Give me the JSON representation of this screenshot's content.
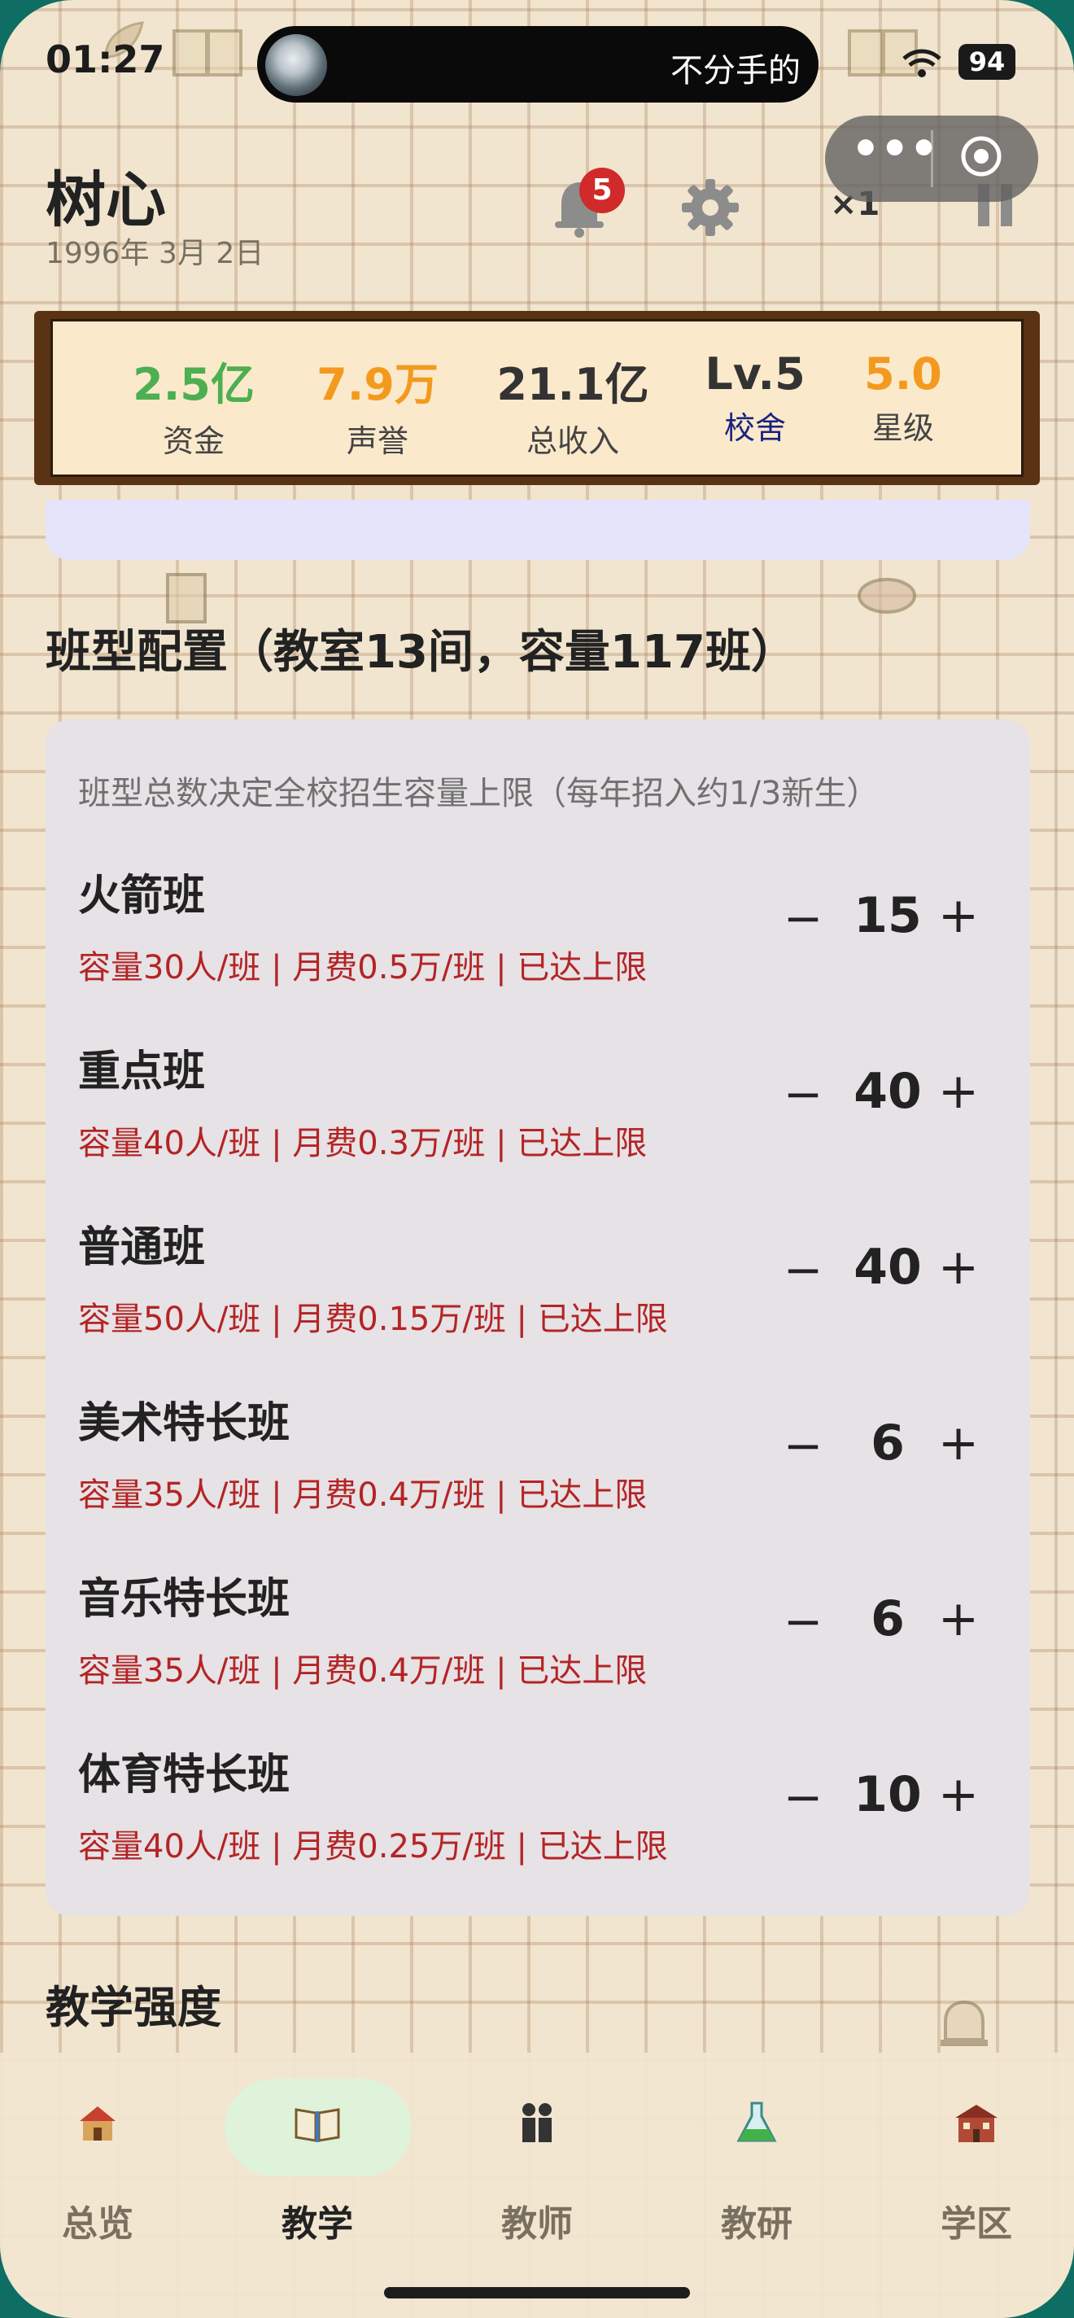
{
  "status_bar": {
    "time": "01:27",
    "notification_text": "不分手的",
    "battery": "94"
  },
  "header": {
    "title": "树心",
    "date": "1996年 3月 2日",
    "notification_count": "5",
    "speed": "×1"
  },
  "stats": [
    {
      "value": "2.5亿",
      "label": "资金",
      "value_color": "#4caf50",
      "label_color": "#444444"
    },
    {
      "value": "7.9万",
      "label": "声誉",
      "value_color": "#f39a1e",
      "label_color": "#444444"
    },
    {
      "value": "21.1亿",
      "label": "总收入",
      "value_color": "#333333",
      "label_color": "#444444"
    },
    {
      "value": "Lv.5",
      "label": "校舍",
      "value_color": "#333333",
      "label_color": "#1a237e"
    },
    {
      "value": "5.0",
      "label": "星级",
      "value_color": "#f39a1e",
      "label_color": "#444444"
    }
  ],
  "class_config": {
    "title": "班型配置（教室13间，容量117班）",
    "note": "班型总数决定全校招生容量上限（每年招入约1/3新生）",
    "minus_label": "−",
    "plus_label": "+",
    "rows": [
      {
        "name": "火箭班",
        "info": "容量30人/班 | 月费0.5万/班 | 已达上限",
        "count": "15"
      },
      {
        "name": "重点班",
        "info": "容量40人/班 | 月费0.3万/班 | 已达上限",
        "count": "40"
      },
      {
        "name": "普通班",
        "info": "容量50人/班 | 月费0.15万/班 | 已达上限",
        "count": "40"
      },
      {
        "name": "美术特长班",
        "info": "容量35人/班 | 月费0.4万/班 | 已达上限",
        "count": "6"
      },
      {
        "name": "音乐特长班",
        "info": "容量35人/班 | 月费0.4万/班 | 已达上限",
        "count": "6"
      },
      {
        "name": "体育特长班",
        "info": "容量40人/班 | 月费0.25万/班 | 已达上限",
        "count": "10"
      }
    ]
  },
  "teaching_intensity": {
    "title": "教学强度"
  },
  "nav": [
    {
      "label": "总览",
      "icon": "school-house-icon",
      "active": false
    },
    {
      "label": "教学",
      "icon": "open-book-icon",
      "active": true
    },
    {
      "label": "教师",
      "icon": "teachers-icon",
      "active": false
    },
    {
      "label": "教研",
      "icon": "flask-icon",
      "active": false
    },
    {
      "label": "学区",
      "icon": "school-building-icon",
      "active": false
    }
  ],
  "colors": {
    "accent_green": "#4caf50",
    "accent_orange": "#f39a1e",
    "limit_red": "#b42424",
    "active_tab_bg": "#dff2da"
  }
}
